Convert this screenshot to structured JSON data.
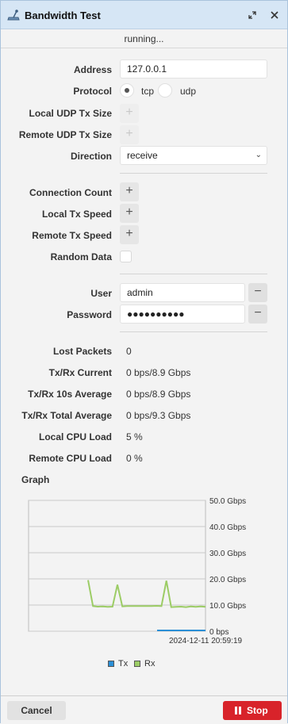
{
  "window": {
    "title": "Bandwidth Test",
    "status": "running..."
  },
  "form": {
    "address_label": "Address",
    "address_value": "127.0.0.1",
    "protocol_label": "Protocol",
    "protocol_options": [
      "tcp",
      "udp"
    ],
    "protocol_selected": "tcp",
    "local_udp_tx_size_label": "Local UDP Tx Size",
    "remote_udp_tx_size_label": "Remote UDP Tx Size",
    "direction_label": "Direction",
    "direction_value": "receive",
    "connection_count_label": "Connection Count",
    "local_tx_speed_label": "Local Tx Speed",
    "remote_tx_speed_label": "Remote Tx Speed",
    "random_data_label": "Random Data",
    "user_label": "User",
    "user_value": "admin",
    "password_label": "Password",
    "password_value": "●●●●●●●●●●",
    "add_glyph": "+",
    "remove_glyph": "−"
  },
  "stats": [
    {
      "label": "Lost Packets",
      "value": "0"
    },
    {
      "label": "Tx/Rx Current",
      "value": "0 bps/8.9 Gbps"
    },
    {
      "label": "Tx/Rx 10s Average",
      "value": "0 bps/8.9 Gbps"
    },
    {
      "label": "Tx/Rx Total Average",
      "value": "0 bps/9.3 Gbps"
    },
    {
      "label": "Local CPU Load",
      "value": "5 %"
    },
    {
      "label": "Remote CPU Load",
      "value": "0 %"
    }
  ],
  "graph": {
    "title": "Graph",
    "y_ticks": [
      "50.0 Gbps",
      "40.0 Gbps",
      "30.0 Gbps",
      "20.0 Gbps",
      "10.0 Gbps",
      "0 bps"
    ],
    "x_label": "2024-12-11 20:59:19",
    "legend": [
      {
        "name": "Tx",
        "color": "#2b8fd6"
      },
      {
        "name": "Rx",
        "color": "#9ccc65"
      }
    ],
    "rx_series": [
      19.5,
      9.6,
      9.4,
      9.5,
      9.3,
      9.4,
      17.8,
      9.5,
      9.6,
      9.6,
      9.6,
      9.6,
      9.6,
      9.6,
      9.7,
      9.6,
      19.3,
      9.2,
      9.3,
      9.4,
      9.2,
      9.5,
      9.3,
      9.5,
      9.3
    ],
    "tx_series": [
      0,
      0,
      0,
      0,
      0,
      0,
      0
    ],
    "ylim": [
      0,
      50
    ]
  },
  "buttons": {
    "cancel": "Cancel",
    "stop": "Stop"
  },
  "colors": {
    "titlebar": "#d6e6f5",
    "stop": "#d8232a",
    "tx": "#2b8fd6",
    "rx": "#9ccc65"
  }
}
